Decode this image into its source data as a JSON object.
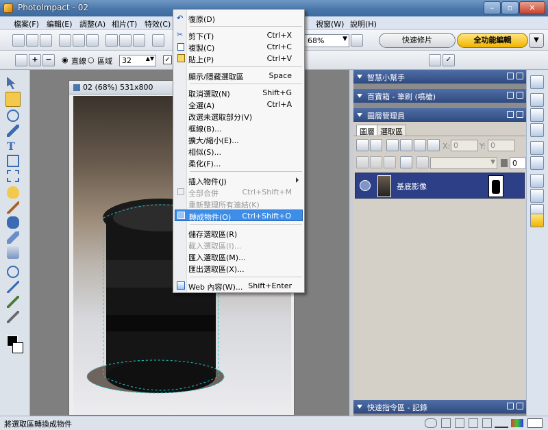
{
  "window": {
    "title": "PhotoImpact - 02"
  },
  "menubar": {
    "items": [
      "檔案(F)",
      "編輯(E)",
      "調整(A)",
      "相片(T)",
      "特效(C)",
      "視窗(W)",
      "說明(H)"
    ]
  },
  "toolbar": {
    "zoom_value": "68%",
    "quick_fix_label": "快速修片",
    "full_edit_label": "全功能編輯",
    "mode_line_label": "直線",
    "mode_region_label": "區域",
    "size_value": "32"
  },
  "document": {
    "title": "02 (68%) 531x800"
  },
  "context_menu": {
    "items": [
      {
        "label": "復原(D)",
        "shortcut": "",
        "disabled": false,
        "icon": "undo-icon"
      },
      {
        "label": "剪下(T)",
        "shortcut": "Ctrl+X",
        "disabled": false,
        "icon": "scissors-icon"
      },
      {
        "label": "複製(C)",
        "shortcut": "Ctrl+C",
        "disabled": false,
        "icon": "copy-icon"
      },
      {
        "label": "貼上(P)",
        "shortcut": "Ctrl+V",
        "disabled": false,
        "icon": "paste-icon"
      },
      {
        "label": "顯示/隱藏選取區",
        "shortcut": "Space",
        "disabled": false
      },
      {
        "label": "取消選取(N)",
        "shortcut": "Shift+G",
        "disabled": false
      },
      {
        "label": "全選(A)",
        "shortcut": "Ctrl+A",
        "disabled": false
      },
      {
        "label": "改選未選取部分(V)",
        "shortcut": "",
        "disabled": false
      },
      {
        "label": "框線(B)...",
        "shortcut": "",
        "disabled": false
      },
      {
        "label": "擴大/縮小(E)...",
        "shortcut": "",
        "disabled": false
      },
      {
        "label": "相似(S)...",
        "shortcut": "",
        "disabled": false
      },
      {
        "label": "柔化(F)...",
        "shortcut": "",
        "disabled": false
      },
      {
        "label": "插入物件(J)",
        "shortcut": "",
        "disabled": false,
        "submenu": true
      },
      {
        "label": "全部合併",
        "shortcut": "Ctrl+Shift+M",
        "disabled": true,
        "icon": "merge-icon"
      },
      {
        "label": "重新整理所有連結(K)",
        "shortcut": "",
        "disabled": true
      },
      {
        "label": "轉成物件(O)",
        "shortcut": "Ctrl+Shift+O",
        "disabled": false,
        "highlighted": true,
        "icon": "convert-object-icon"
      },
      {
        "label": "儲存選取區(R)",
        "shortcut": "",
        "disabled": false
      },
      {
        "label": "載入選取區(I)...",
        "shortcut": "",
        "disabled": true
      },
      {
        "label": "匯入選取區(M)...",
        "shortcut": "",
        "disabled": false
      },
      {
        "label": "匯出選取區(X)...",
        "shortcut": "",
        "disabled": false
      },
      {
        "label": "Web 內容(W)...",
        "shortcut": "Shift+Enter",
        "disabled": false,
        "icon": "web-icon"
      }
    ]
  },
  "panels": {
    "smart_helper": "智慧小幫手",
    "easy_palette": "百寶箱 - 筆刷 (噴槍)",
    "layer_manager": "圖層管理員",
    "quick_command": "快速指令區 - 記錄"
  },
  "layers": {
    "tabs": [
      "圖層",
      "選取區"
    ],
    "x_label": "X:",
    "x_value": "0",
    "y_label": "Y:",
    "y_value": "0",
    "opacity_value": "0",
    "base_layer": "基底影像"
  },
  "status": {
    "message": "將選取區轉換成物件"
  },
  "colors": {
    "titlebar": "#4a77ab",
    "panel_header": "#2f4a7f",
    "highlight": "#3e8ee8",
    "layer_row": "#2c3f87"
  }
}
